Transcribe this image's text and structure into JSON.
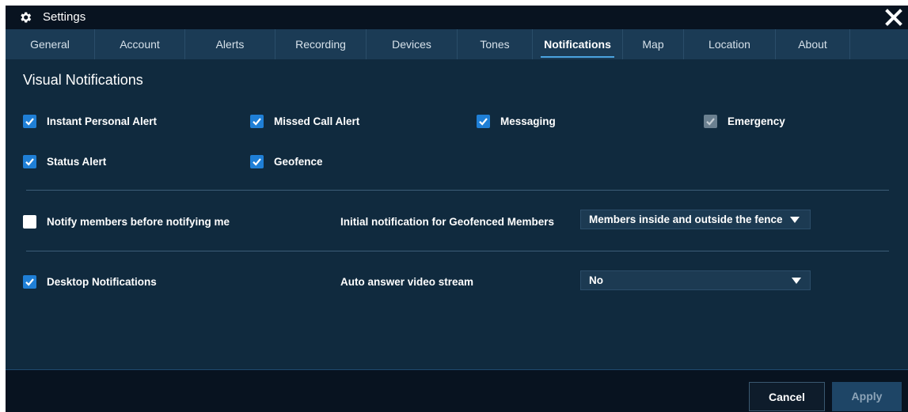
{
  "window": {
    "title": "Settings"
  },
  "tabs": [
    {
      "label": "General",
      "active": false
    },
    {
      "label": "Account",
      "active": false
    },
    {
      "label": "Alerts",
      "active": false
    },
    {
      "label": "Recording",
      "active": false
    },
    {
      "label": "Devices",
      "active": false
    },
    {
      "label": "Tones",
      "active": false
    },
    {
      "label": "Notifications",
      "active": true
    },
    {
      "label": "Map",
      "active": false
    },
    {
      "label": "Location",
      "active": false
    },
    {
      "label": "About",
      "active": false
    }
  ],
  "visual_notifications": {
    "title": "Visual Notifications",
    "items": [
      {
        "label": "Instant Personal Alert",
        "checked": true,
        "disabled": false
      },
      {
        "label": "Missed Call Alert",
        "checked": true,
        "disabled": false
      },
      {
        "label": "Messaging",
        "checked": true,
        "disabled": false
      },
      {
        "label": "Emergency",
        "checked": true,
        "disabled": true
      },
      {
        "label": "Status Alert",
        "checked": true,
        "disabled": false
      },
      {
        "label": "Geofence",
        "checked": true,
        "disabled": false
      }
    ]
  },
  "notify_members": {
    "label": "Notify members before notifying me",
    "checked": false
  },
  "geofence_initial": {
    "label": "Initial notification for Geofenced Members",
    "value": "Members inside and outside the fence"
  },
  "desktop_notifications": {
    "label": "Desktop Notifications",
    "checked": true
  },
  "auto_answer": {
    "label": "Auto answer video stream",
    "value": "No"
  },
  "footer": {
    "cancel_label": "Cancel",
    "apply_label": "Apply"
  },
  "colors": {
    "background": "#102a3e",
    "titlebar": "#081320",
    "tabbar": "#1b3b55",
    "checkbox_checked": "#1f7fd6",
    "active_tab_underline": "#4aa3e0"
  },
  "icons": [
    "gear-icon",
    "close-icon",
    "checkmark-icon",
    "dropdown-arrow-icon"
  ]
}
